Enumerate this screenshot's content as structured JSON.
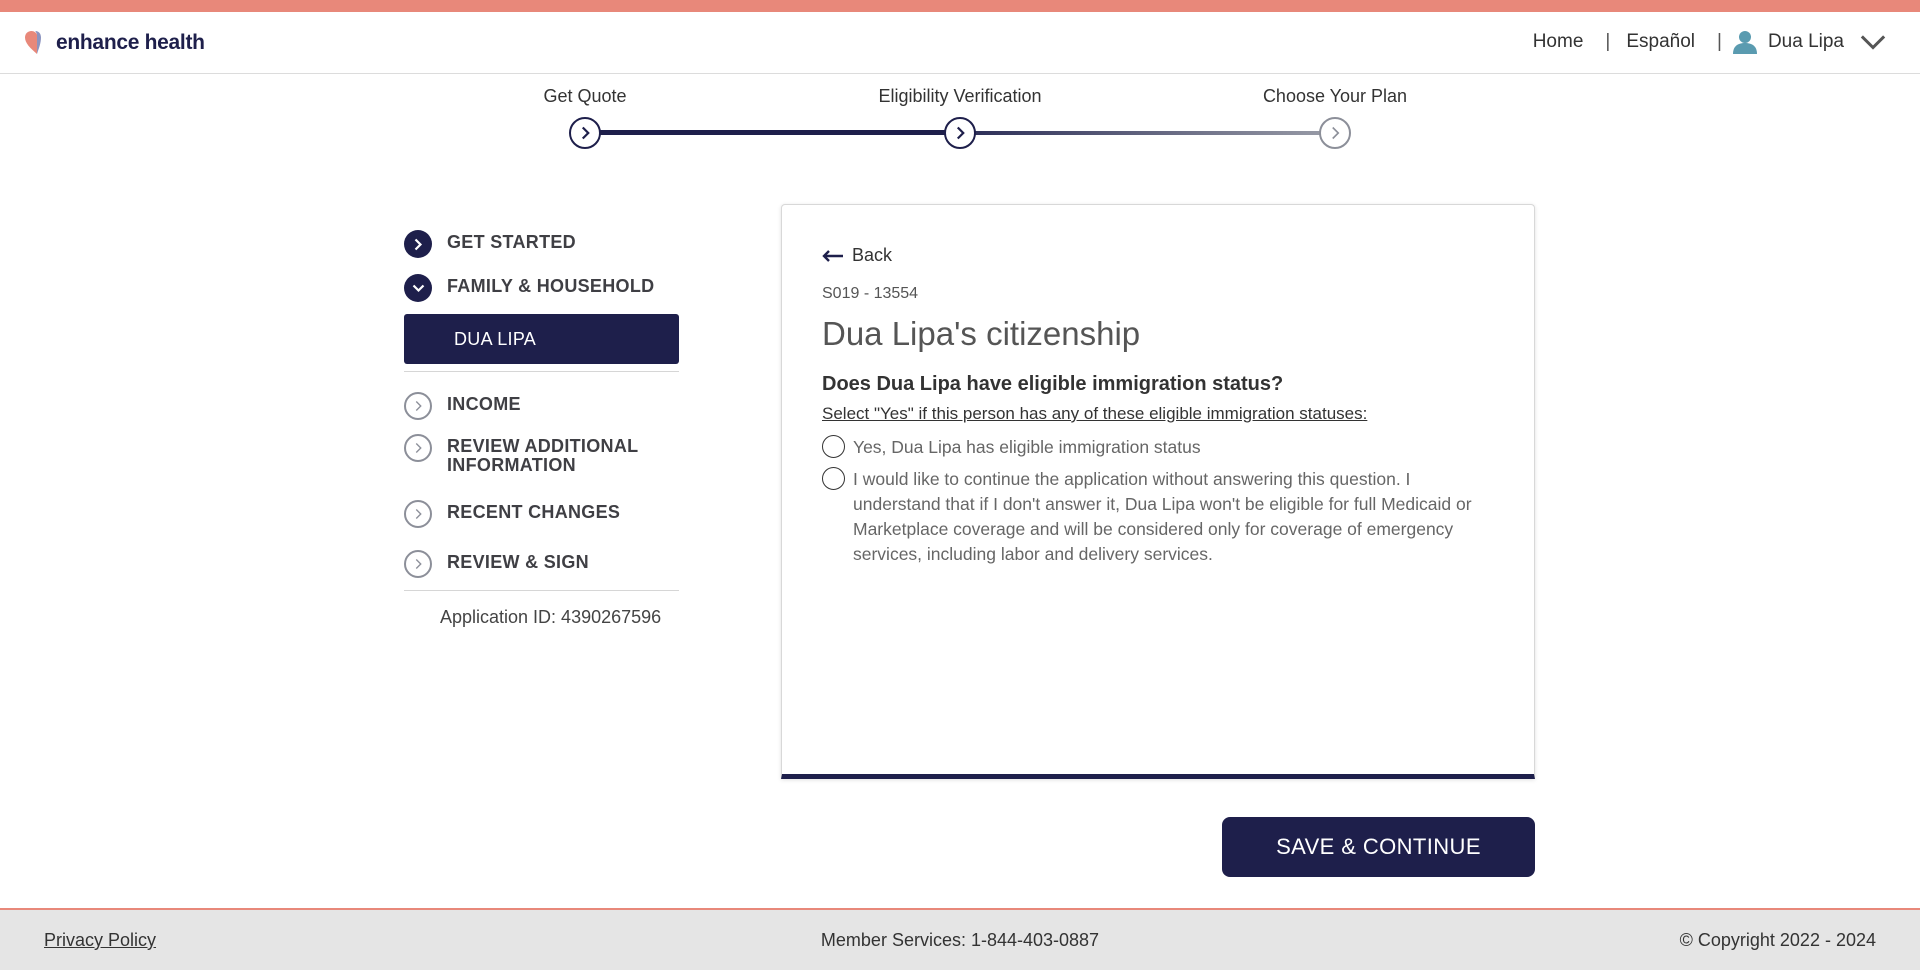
{
  "brand": {
    "name": "enhance health",
    "accent_color": "#e8887a",
    "primary_color": "#1e1f4b"
  },
  "nav": {
    "home": "Home",
    "language": "Español",
    "user_name": "Dua Lipa"
  },
  "stepper": {
    "steps": [
      {
        "label": "Get Quote",
        "status": "complete"
      },
      {
        "label": "Eligibility Verification",
        "status": "current"
      },
      {
        "label": "Choose Your Plan",
        "status": "upcoming"
      }
    ]
  },
  "sidebar": {
    "items": [
      {
        "label": "GET STARTED",
        "icon": "chevron-right-icon",
        "state": "complete"
      },
      {
        "label": "FAMILY & HOUSEHOLD",
        "icon": "chevron-down-icon",
        "state": "expanded"
      },
      {
        "label": "INCOME",
        "icon": "chevron-right-icon",
        "state": "upcoming"
      },
      {
        "label": "REVIEW ADDITIONAL INFORMATION",
        "icon": "chevron-right-icon",
        "state": "upcoming"
      },
      {
        "label": "RECENT CHANGES",
        "icon": "chevron-right-icon",
        "state": "upcoming"
      },
      {
        "label": "REVIEW & SIGN",
        "icon": "chevron-right-icon",
        "state": "upcoming"
      }
    ],
    "active_subitem": "DUA LIPA",
    "application_id": "Application ID: 4390267596"
  },
  "card": {
    "back_label": "Back",
    "code": "S019 - 13554",
    "title": "Dua Lipa's citizenship",
    "question": "Does Dua Lipa have eligible immigration status?",
    "hint": "Select \"Yes\" if this person has any of these eligible immigration statuses:",
    "options": [
      "Yes, Dua Lipa has eligible immigration status",
      "I would like to continue the application without answering this question. I understand that if I don't answer it, Dua Lipa won't be eligible for full Medicaid or Marketplace coverage and will be considered only for coverage of emergency services, including labor and delivery services."
    ]
  },
  "actions": {
    "save_continue": "SAVE & CONTINUE"
  },
  "footer": {
    "privacy": "Privacy Policy",
    "member_services": "Member Services: 1-844-403-0887",
    "copyright": "© Copyright 2022 - 2024"
  }
}
